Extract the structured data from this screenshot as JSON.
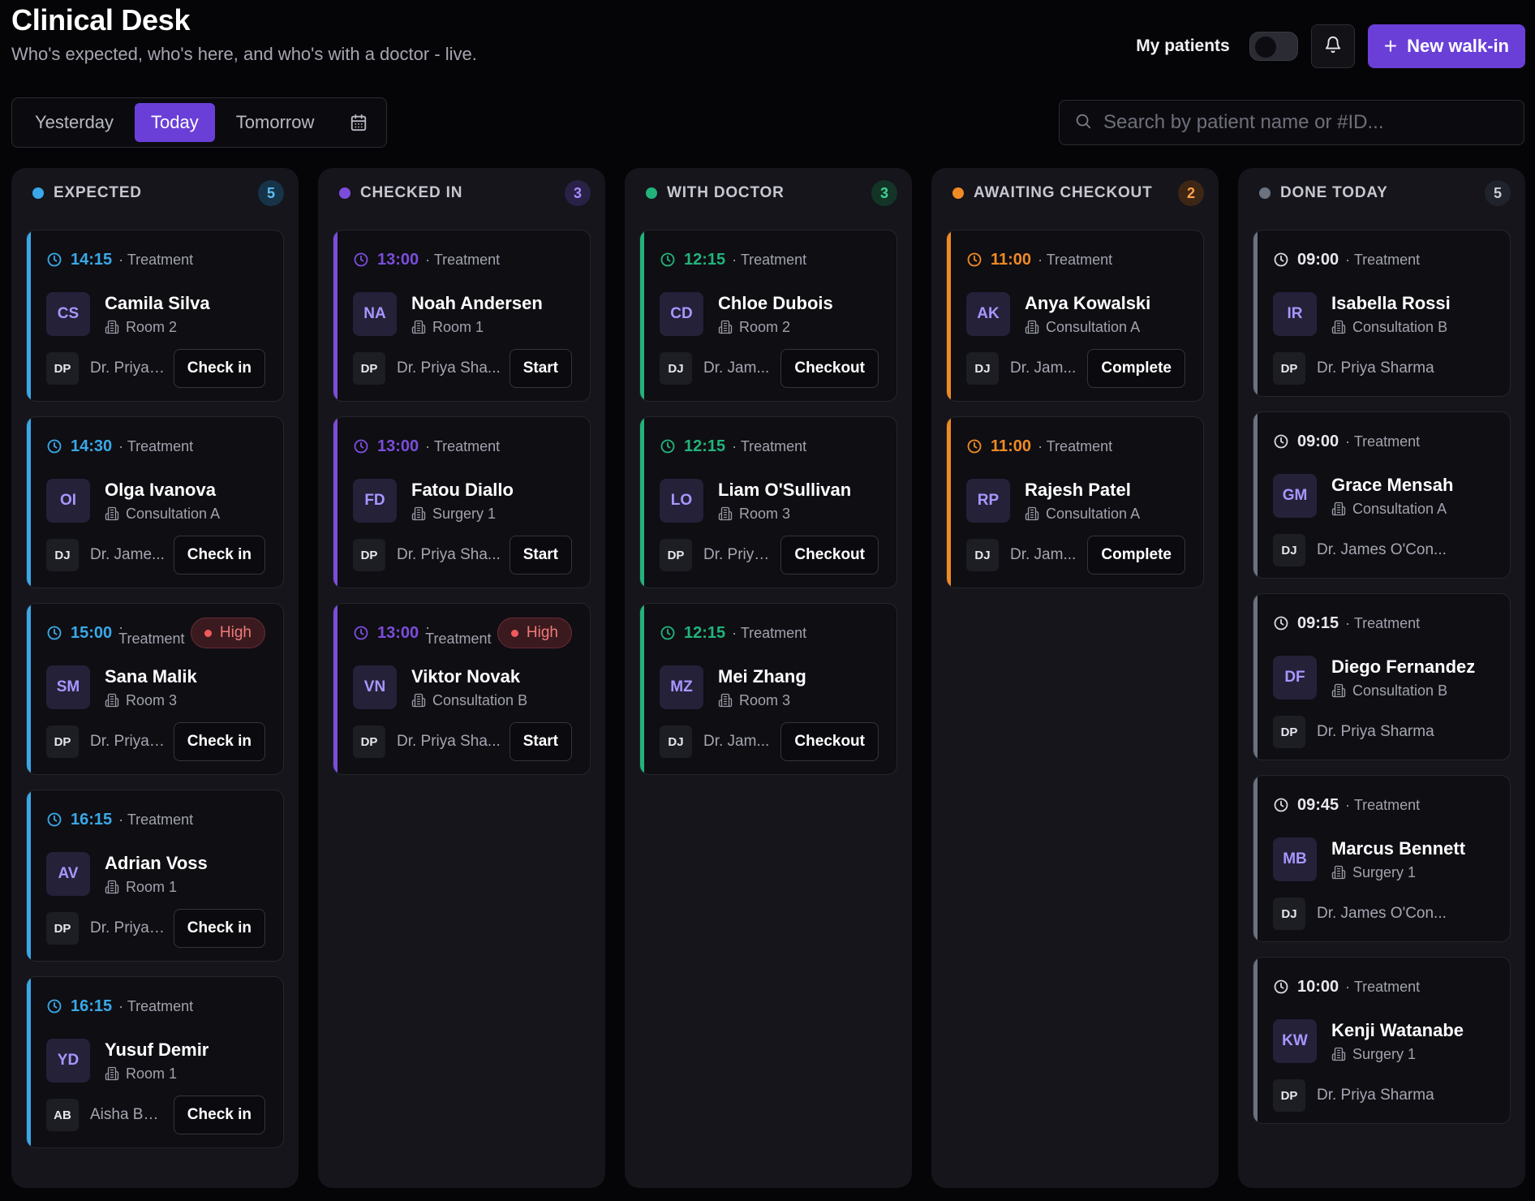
{
  "app": {
    "title": "Clinical Desk",
    "subtitle": "Who's expected, who's here, and who's with a doctor - live."
  },
  "header": {
    "my_patients_label": "My patients",
    "new_walkin_label": "New walk-in"
  },
  "date_tabs": [
    "Yesterday",
    "Today",
    "Tomorrow"
  ],
  "active_date_tab": "Today",
  "search": {
    "placeholder": "Search by patient name or #ID..."
  },
  "colors": {
    "expected": "#3aa8e8",
    "checked_in": "#7c4ddb",
    "with_doctor": "#23b37a",
    "awaiting_checkout": "#f08a24",
    "done_today": "#6b7280",
    "accent": "#6a3fd8"
  },
  "columns": {
    "expected": {
      "title": "EXPECTED",
      "count": "5",
      "cards": [
        {
          "time": "14:15",
          "type": "· Treatment",
          "initials": "CS",
          "name": "Camila Silva",
          "room": "Room 2",
          "doctor_initials": "DP",
          "doctor": "Dr. Priya ...",
          "action": "Check in"
        },
        {
          "time": "14:30",
          "type": "· Treatment",
          "initials": "OI",
          "name": "Olga Ivanova",
          "room": "Consultation A",
          "doctor_initials": "DJ",
          "doctor": "Dr. Jame...",
          "action": "Check in"
        },
        {
          "time": "15:00",
          "type_dot": "·",
          "type": "Treatment",
          "priority": "High",
          "initials": "SM",
          "name": "Sana Malik",
          "room": "Room 3",
          "doctor_initials": "DP",
          "doctor": "Dr. Priya ...",
          "action": "Check in"
        },
        {
          "time": "16:15",
          "type": "· Treatment",
          "initials": "AV",
          "name": "Adrian Voss",
          "room": "Room 1",
          "doctor_initials": "DP",
          "doctor": "Dr. Priya ...",
          "action": "Check in"
        },
        {
          "time": "16:15",
          "type": "· Treatment",
          "initials": "YD",
          "name": "Yusuf Demir",
          "room": "Room 1",
          "doctor_initials": "AB",
          "doctor": "Aisha Bello",
          "action": "Check in"
        }
      ]
    },
    "checked_in": {
      "title": "CHECKED IN",
      "count": "3",
      "cards": [
        {
          "time": "13:00",
          "type": "· Treatment",
          "initials": "NA",
          "name": "Noah Andersen",
          "room": "Room 1",
          "doctor_initials": "DP",
          "doctor": "Dr. Priya Sha...",
          "action": "Start"
        },
        {
          "time": "13:00",
          "type": "· Treatment",
          "initials": "FD",
          "name": "Fatou Diallo",
          "room": "Surgery 1",
          "doctor_initials": "DP",
          "doctor": "Dr. Priya Sha...",
          "action": "Start"
        },
        {
          "time": "13:00",
          "type_dot": "·",
          "type": "Treatment",
          "priority": "High",
          "initials": "VN",
          "name": "Viktor Novak",
          "room": "Consultation B",
          "doctor_initials": "DP",
          "doctor": "Dr. Priya Sha...",
          "action": "Start"
        }
      ]
    },
    "with_doctor": {
      "title": "WITH DOCTOR",
      "count": "3",
      "cards": [
        {
          "time": "12:15",
          "type": "· Treatment",
          "initials": "CD",
          "name": "Chloe Dubois",
          "room": "Room 2",
          "doctor_initials": "DJ",
          "doctor": "Dr. Jam...",
          "action": "Checkout"
        },
        {
          "time": "12:15",
          "type": "· Treatment",
          "initials": "LO",
          "name": "Liam O'Sullivan",
          "room": "Room 3",
          "doctor_initials": "DP",
          "doctor": "Dr. Priya...",
          "action": "Checkout"
        },
        {
          "time": "12:15",
          "type": "· Treatment",
          "initials": "MZ",
          "name": "Mei Zhang",
          "room": "Room 3",
          "doctor_initials": "DJ",
          "doctor": "Dr. Jam...",
          "action": "Checkout"
        }
      ]
    },
    "awaiting_checkout": {
      "title": "AWAITING CHECKOUT",
      "count": "2",
      "cards": [
        {
          "time": "11:00",
          "type": "· Treatment",
          "initials": "AK",
          "name": "Anya Kowalski",
          "room": "Consultation A",
          "doctor_initials": "DJ",
          "doctor": "Dr. Jam...",
          "action": "Complete"
        },
        {
          "time": "11:00",
          "type": "· Treatment",
          "initials": "RP",
          "name": "Rajesh Patel",
          "room": "Consultation A",
          "doctor_initials": "DJ",
          "doctor": "Dr. Jam...",
          "action": "Complete"
        }
      ]
    },
    "done_today": {
      "title": "DONE TODAY",
      "count": "5",
      "cards": [
        {
          "time": "09:00",
          "type": "· Treatment",
          "initials": "IR",
          "name": "Isabella Rossi",
          "room": "Consultation B",
          "doctor_initials": "DP",
          "doctor": "Dr. Priya Sharma"
        },
        {
          "time": "09:00",
          "type": "· Treatment",
          "initials": "GM",
          "name": "Grace Mensah",
          "room": "Consultation A",
          "doctor_initials": "DJ",
          "doctor": "Dr. James O'Con..."
        },
        {
          "time": "09:15",
          "type": "· Treatment",
          "initials": "DF",
          "name": "Diego Fernandez",
          "room": "Consultation B",
          "doctor_initials": "DP",
          "doctor": "Dr. Priya Sharma"
        },
        {
          "time": "09:45",
          "type": "· Treatment",
          "initials": "MB",
          "name": "Marcus Bennett",
          "room": "Surgery 1",
          "doctor_initials": "DJ",
          "doctor": "Dr. James O'Con..."
        },
        {
          "time": "10:00",
          "type": "· Treatment",
          "initials": "KW",
          "name": "Kenji Watanabe",
          "room": "Surgery 1",
          "doctor_initials": "DP",
          "doctor": "Dr. Priya Sharma"
        }
      ]
    }
  }
}
